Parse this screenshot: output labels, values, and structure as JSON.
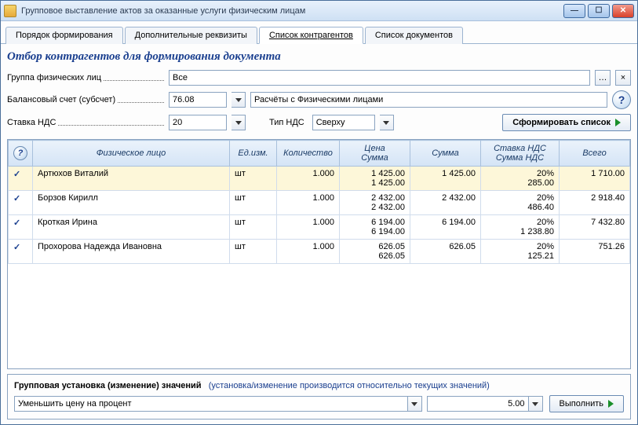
{
  "window": {
    "title": "Групповое выставление актов за оказанные услуги физическим лицам"
  },
  "tabs": [
    "Порядок формирования",
    "Дополнительные реквизиты",
    "Список контрагентов",
    "Список документов"
  ],
  "active_tab": 2,
  "section_title": "Отбор контрагентов для формирования документа",
  "form": {
    "group_label": "Группа физических лиц",
    "group_value": "Все",
    "account_label": "Балансовый счет (субсчет)",
    "account_value": "76.08",
    "account_desc": "Расчёты с Физическими лицами",
    "vat_rate_label": "Ставка НДС",
    "vat_rate_value": "20",
    "vat_type_label": "Тип НДС",
    "vat_type_value": "Сверху",
    "build_btn": "Сформировать список"
  },
  "table": {
    "headers": [
      "",
      "Физическое лицо",
      "Ед.изм.",
      "Количество",
      "Цена\nСумма",
      "Сумма",
      "Ставка НДС\nСумма НДС",
      "Всего"
    ],
    "rows": [
      {
        "checked": true,
        "name": "Артюхов Виталий",
        "unit": "шт",
        "qty": "1.000",
        "price": "1 425.00",
        "price2": "1 425.00",
        "sum": "1 425.00",
        "vat": "20%",
        "vat_sum": "285.00",
        "total": "1 710.00",
        "selected": true
      },
      {
        "checked": true,
        "name": "Борзов Кирилл",
        "unit": "шт",
        "qty": "1.000",
        "price": "2 432.00",
        "price2": "2 432.00",
        "sum": "2 432.00",
        "vat": "20%",
        "vat_sum": "486.40",
        "total": "2 918.40"
      },
      {
        "checked": true,
        "name": "Кроткая Ирина",
        "unit": "шт",
        "qty": "1.000",
        "price": "6 194.00",
        "price2": "6 194.00",
        "sum": "6 194.00",
        "vat": "20%",
        "vat_sum": "1 238.80",
        "total": "7 432.80"
      },
      {
        "checked": true,
        "name": "Прохорова Надежда Ивановна",
        "unit": "шт",
        "qty": "1.000",
        "price": "626.05",
        "price2": "626.05",
        "sum": "626.05",
        "vat": "20%",
        "vat_sum": "125.21",
        "total": "751.26"
      }
    ]
  },
  "bottom": {
    "title": "Групповая установка (изменение) значений",
    "hint": "(установка/изменение производится относительно текущих значений)",
    "mode": "Уменьшить цену на процент",
    "value": "5.00",
    "exec_btn": "Выполнить"
  }
}
